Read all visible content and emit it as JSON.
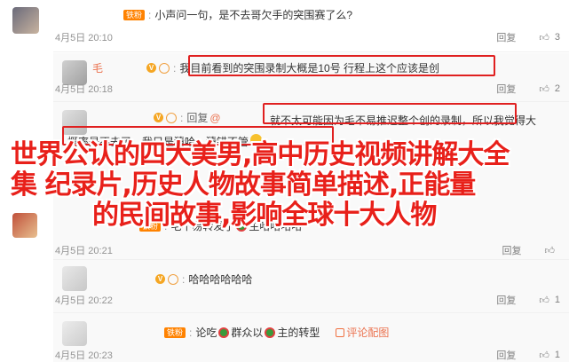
{
  "comments": [
    {
      "user": "",
      "fan_badge": "铁粉",
      "text": "小声问一句，是不去哥欠手的突围赛了么?",
      "time": "4月5日 20:10",
      "reply": "回复",
      "likes": "3"
    },
    {
      "user": "毛",
      "fan_badge": "",
      "text": "我目前看到的突围录制大概是10号 行程上这个应该是创",
      "time": "4月5日 20:18",
      "reply": "回复",
      "likes": "2"
    },
    {
      "user": "",
      "fan_badge": "",
      "reply_prefix": "回复",
      "reply_to": "@",
      "text": "就不太可能因为毛不易推迟整个创的录制，所以我觉得大概率是不去了，我只是猜哈，猜错不管",
      "time": "4月5日 20:21",
      "reply": "回复",
      "likes": "1"
    },
    {
      "user": "",
      "fan_badge": "铁粉",
      "text": "毛不易转发了",
      "text2": "主哈哈哈哈",
      "time": "4月5日 20:21",
      "reply": "回复",
      "likes": ""
    },
    {
      "user": "",
      "fan_badge": "",
      "text": "哈哈哈哈哈哈",
      "time": "4月5日 20:22",
      "reply": "回复",
      "likes": "1"
    },
    {
      "user": "",
      "fan_badge": "铁粉",
      "text": "论吃",
      "text2": "群众以",
      "text3": "主的转型",
      "repost_label": "评论配图",
      "time": "4月5日 20:23",
      "reply": "回复",
      "likes": "1"
    }
  ],
  "overlay": {
    "line1": "世界公认的四大美男,高中历史视频讲解大全",
    "line2": "集 纪录片,历史人物故事简单描述,正能量",
    "line3": "的民间故事,影响全球十大人物"
  },
  "colors": {
    "overlay_text": "#e8201a",
    "highlight_box": "#e02020",
    "username": "#eb7350"
  }
}
